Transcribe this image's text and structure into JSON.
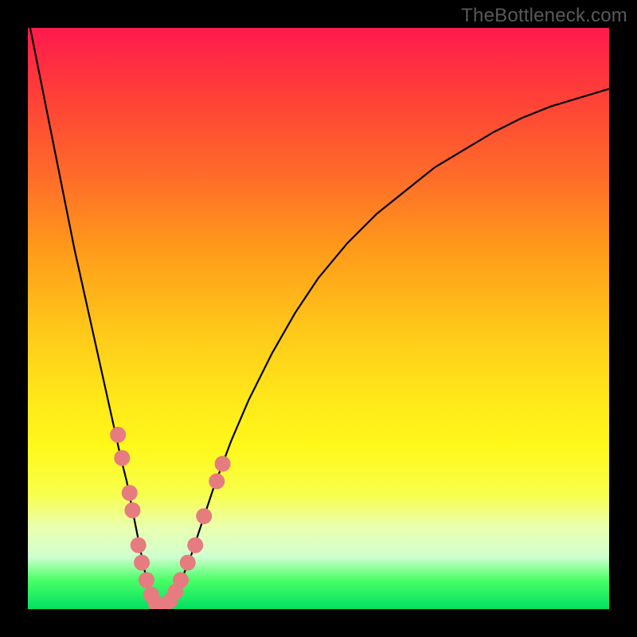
{
  "watermark": "TheBottleneck.com",
  "colors": {
    "curve": "#000000",
    "markers_fill": "#e67b80",
    "markers_stroke": "#c45a60",
    "frame_bg": "#000000"
  },
  "chart_data": {
    "type": "line",
    "title": "",
    "xlabel": "",
    "ylabel": "",
    "xlim": [
      0,
      100
    ],
    "ylim": [
      0,
      100
    ],
    "grid": false,
    "series": [
      {
        "name": "bottleneck-curve",
        "x": [
          0,
          2,
          4,
          6,
          8,
          10,
          12,
          14,
          16,
          17,
          18,
          19,
          20,
          21,
          22,
          23,
          24,
          26,
          28,
          30,
          32,
          35,
          38,
          42,
          46,
          50,
          55,
          60,
          65,
          70,
          75,
          80,
          85,
          90,
          95,
          100
        ],
        "values": [
          102,
          92,
          82,
          72,
          62,
          53,
          44,
          35,
          26,
          22,
          17,
          12,
          7,
          3,
          1,
          0.3,
          1,
          4,
          9,
          15,
          21,
          29,
          36,
          44,
          51,
          57,
          63,
          68,
          72,
          76,
          79,
          82,
          84.5,
          86.5,
          88,
          89.5
        ]
      }
    ],
    "markers": {
      "name": "sample-points",
      "points": [
        {
          "x": 15.5,
          "y": 30
        },
        {
          "x": 16.2,
          "y": 26
        },
        {
          "x": 17.5,
          "y": 20
        },
        {
          "x": 18.0,
          "y": 17
        },
        {
          "x": 19.0,
          "y": 11
        },
        {
          "x": 19.6,
          "y": 8
        },
        {
          "x": 20.4,
          "y": 5
        },
        {
          "x": 21.2,
          "y": 2.5
        },
        {
          "x": 22.0,
          "y": 1
        },
        {
          "x": 22.8,
          "y": 0.3
        },
        {
          "x": 23.6,
          "y": 0.6
        },
        {
          "x": 24.5,
          "y": 1.5
        },
        {
          "x": 25.4,
          "y": 3
        },
        {
          "x": 26.3,
          "y": 5
        },
        {
          "x": 27.5,
          "y": 8
        },
        {
          "x": 28.8,
          "y": 11
        },
        {
          "x": 30.3,
          "y": 16
        },
        {
          "x": 32.5,
          "y": 22
        },
        {
          "x": 33.5,
          "y": 25
        }
      ],
      "radius": 10
    }
  }
}
